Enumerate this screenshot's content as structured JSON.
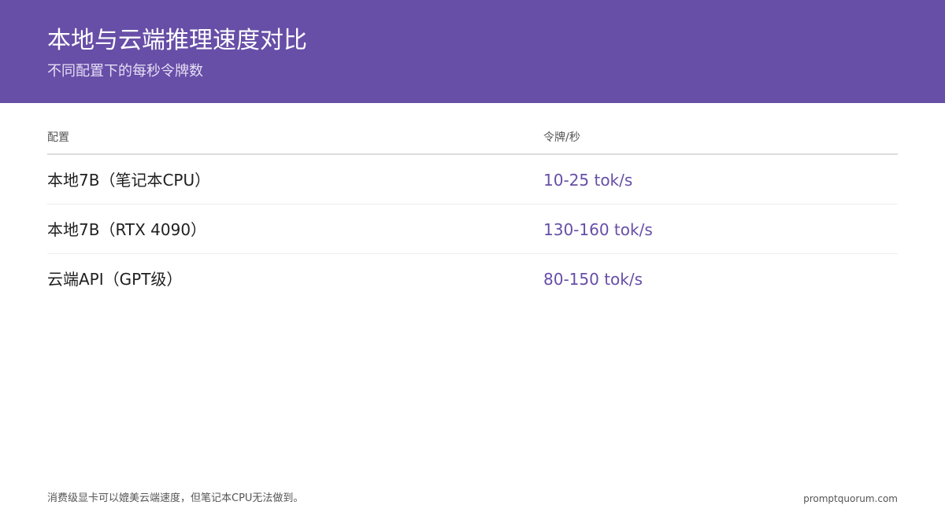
{
  "header": {
    "title": "本地与云端推理速度对比",
    "subtitle": "不同配置下的每秒令牌数"
  },
  "table": {
    "columns": [
      "配置",
      "令牌/秒"
    ],
    "rows": [
      {
        "config": "本地7B（笔记本CPU）",
        "speed": "10-25 tok/s"
      },
      {
        "config": "本地7B（RTX 4090）",
        "speed": "130-160 tok/s"
      },
      {
        "config": "云端API（GPT级）",
        "speed": "80-150 tok/s"
      }
    ]
  },
  "footer": {
    "note": "消费级显卡可以媲美云端速度，但笔记本CPU无法做到。",
    "brand": "promptquorum.com"
  },
  "colors": {
    "header_bg": "#674ea7",
    "accent": "#674ea7"
  }
}
